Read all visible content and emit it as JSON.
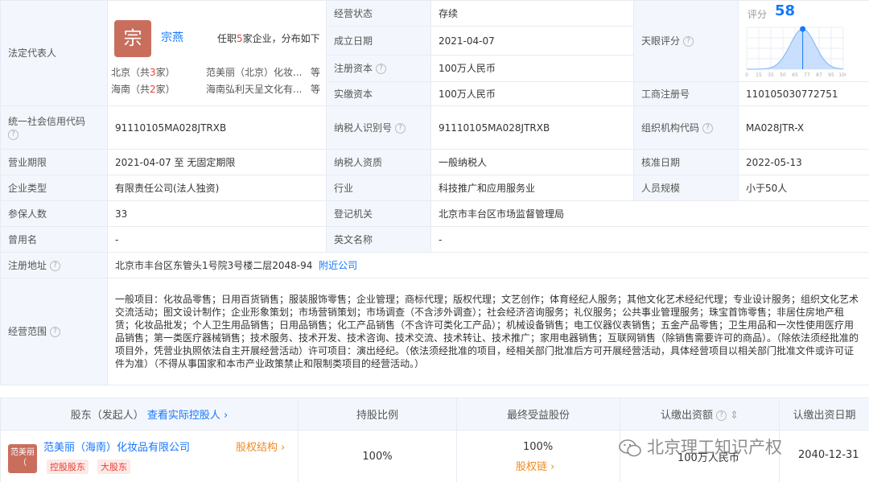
{
  "legal": {
    "label": "法定代表人",
    "avatar_char": "宗",
    "name": "宗燕",
    "tenure_prefix": "任职",
    "tenure_count": "5",
    "tenure_suffix": "家企业，分布如下",
    "region1": "北京（共",
    "region1_count": "3",
    "region1_suffix": "家）",
    "region1_company": "范美丽（北京）化妆...",
    "region2": "海南（共",
    "region2_count": "2",
    "region2_suffix": "家）",
    "region2_company": "海南弘利天呈文化有...",
    "etc": "等"
  },
  "status": {
    "label": "经营状态",
    "value": "存续"
  },
  "found_date": {
    "label": "成立日期",
    "value": "2021-04-07"
  },
  "reg_capital": {
    "label": "注册资本",
    "value": "100万人民币"
  },
  "paid_capital": {
    "label": "实缴资本",
    "value": "100万人民币"
  },
  "tianyan": {
    "label": "天眼评分",
    "score_label": "评分",
    "score": "58",
    "score_fraction": 0.58,
    "axis_ticks": [
      "0",
      "15",
      "35",
      "50",
      "65",
      "77",
      "87",
      "95",
      "100"
    ]
  },
  "biz_reg_no": {
    "label": "工商注册号",
    "value": "110105030772751"
  },
  "credit_code": {
    "label": "统一社会信用代码",
    "value": "91110105MA028JTRXB"
  },
  "taxpayer_id": {
    "label": "纳税人识别号",
    "value": "91110105MA028JTRXB"
  },
  "org_code": {
    "label": "组织机构代码",
    "value": "MA028JTR-X"
  },
  "biz_term": {
    "label": "营业期限",
    "value": "2021-04-07 至 无固定期限"
  },
  "taxpayer_qual": {
    "label": "纳税人资质",
    "value": "一般纳税人"
  },
  "approve_date": {
    "label": "核准日期",
    "value": "2022-05-13"
  },
  "company_type": {
    "label": "企业类型",
    "value": "有限责任公司(法人独资)"
  },
  "industry": {
    "label": "行业",
    "value": "科技推广和应用服务业"
  },
  "staff_size": {
    "label": "人员规模",
    "value": "小于50人"
  },
  "insured": {
    "label": "参保人数",
    "value": "33"
  },
  "reg_authority": {
    "label": "登记机关",
    "value": "北京市丰台区市场监督管理局"
  },
  "former_name": {
    "label": "曾用名",
    "value": "-"
  },
  "en_name": {
    "label": "英文名称",
    "value": "-"
  },
  "address": {
    "label": "注册地址",
    "value": "北京市丰台区东管头1号院3号楼二层2048-94",
    "nearby": "附近公司"
  },
  "scope": {
    "label": "经营范围",
    "value": "一般项目：化妆品零售；日用百货销售；服装服饰零售；企业管理；商标代理；版权代理；文艺创作；体育经纪人服务；其他文化艺术经纪代理；专业设计服务；组织文化艺术交流活动；图文设计制作；企业形象策划；市场营销策划；市场调查（不含涉外调查）；社会经济咨询服务；礼仪服务；公共事业管理服务；珠宝首饰零售；非居住房地产租赁；化妆品批发；个人卫生用品销售；日用品销售；化工产品销售（不含许可类化工产品）；机械设备销售；电工仪器仪表销售；五金产品零售；卫生用品和一次性使用医疗用品销售；第一类医疗器械销售；技术服务、技术开发、技术咨询、技术交流、技术转让、技术推广；家用电器销售；互联网销售（除销售需要许可的商品）。（除依法须经批准的项目外，凭营业执照依法自主开展经营活动）许可项目：演出经纪。（依法须经批准的项目，经相关部门批准后方可开展经营活动，具体经营项目以相关部门批准文件或许可证件为准）（不得从事国家和本市产业政策禁止和限制类项目的经营活动。）"
  },
  "shareholders": {
    "headers": {
      "holder": "股东（发起人）",
      "holder_link": "查看实际控股人",
      "ratio": "持股比例",
      "final_ratio": "最终受益股份",
      "amount": "认缴出资额",
      "date": "认缴出资日期"
    },
    "row": {
      "logo_text": "范美丽（",
      "name": "范美丽（海南）化妆品有限公司",
      "structure": "股权结构",
      "tag1": "控股股东",
      "tag2": "大股东",
      "ratio": "100%",
      "final_ratio": "100%",
      "chain": "股权链",
      "amount": "100万人民币",
      "date": "2040-12-31"
    }
  },
  "watermark": "北京理工知识产权",
  "colors": {
    "accent": "#1677ff",
    "label_bg": "#f3f7fd",
    "border": "#e6ebf2",
    "orange": "#f08a24",
    "red": "#e8403b"
  }
}
